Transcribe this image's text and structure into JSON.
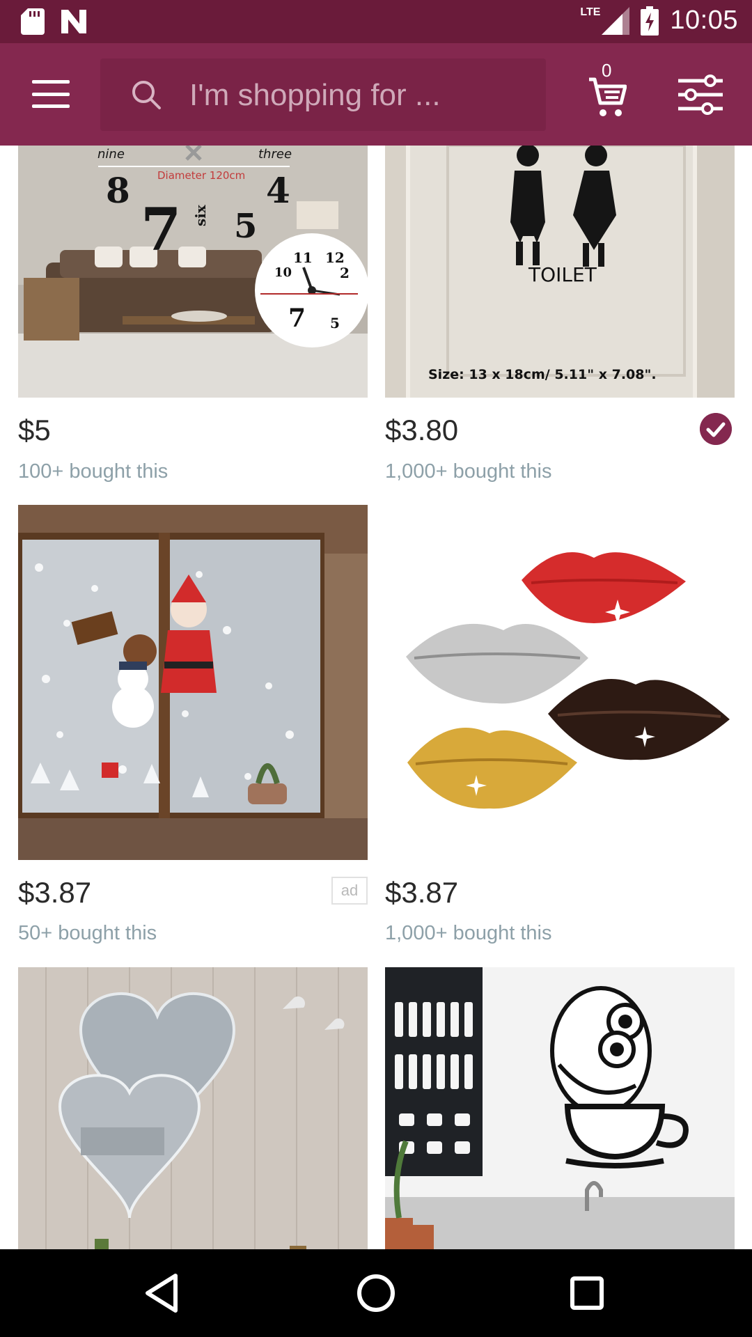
{
  "status_bar": {
    "time": "10:05",
    "network": "LTE",
    "icons": [
      "sd-card-icon",
      "notification-n-icon",
      "lte-signal-icon",
      "battery-charging-icon"
    ]
  },
  "header": {
    "search_placeholder": "I'm shopping for ...",
    "cart_count": "0",
    "icons": [
      "menu-icon",
      "search-icon",
      "cart-icon",
      "filter-icon"
    ]
  },
  "products": [
    {
      "price": "$5",
      "bought": "100+ bought this",
      "image": "diy-wall-clock-living-room",
      "image_text": {
        "nine": "nine",
        "three": "three",
        "diameter": "Diameter 120cm",
        "eight": "8",
        "four": "4",
        "seven": "7",
        "six": "six",
        "five": "5"
      }
    },
    {
      "price": "$3.80",
      "bought": "1,000+ bought this",
      "verified": true,
      "image": "toilet-sign-sticker",
      "image_text": {
        "toilet": "TOILET",
        "size": "Size: 13 x 18cm/ 5.11\" x 7.08\"."
      }
    },
    {
      "price": "$3.87",
      "bought": "50+ bought this",
      "ad": "ad",
      "image": "christmas-window-stickers"
    },
    {
      "price": "$3.87",
      "bought": "1,000+ bought this",
      "image": "lips-mirror-stickers"
    },
    {
      "image": "heart-mirror-wall-sticker"
    },
    {
      "image": "owl-coffee-cup-decal"
    }
  ],
  "nav": {
    "icons": [
      "back-icon",
      "home-icon",
      "recents-icon"
    ]
  },
  "colors": {
    "primary": "#84284f",
    "status": "#6a1b3a",
    "price": "#2a2a2a",
    "secondary_text": "#8da0a8"
  }
}
